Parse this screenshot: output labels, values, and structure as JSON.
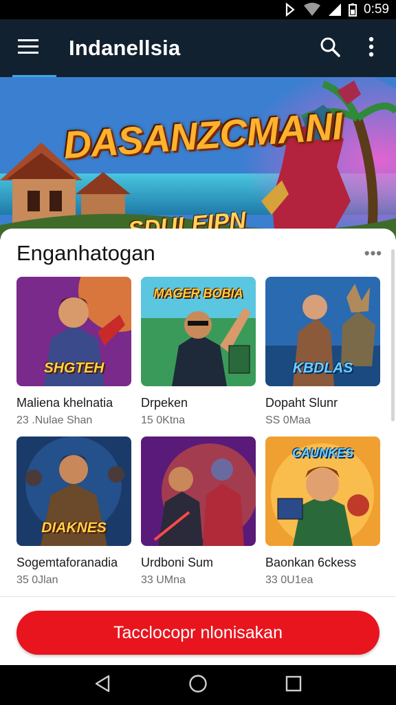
{
  "status_bar": {
    "time": "0:59",
    "icons": [
      "nfc-icon",
      "wifi-icon",
      "signal-icon",
      "battery-icon"
    ]
  },
  "app_bar": {
    "title": "Indanellsia",
    "icons": [
      "menu-icon",
      "search-icon",
      "more-vert-icon"
    ]
  },
  "hero": {
    "title": "DASANZCMANI",
    "subtitle": "SDULEIPN"
  },
  "section": {
    "title": "Enganhatogan",
    "more_label": "•••",
    "games": [
      {
        "title": "Maliena khelnatia",
        "subtitle": "23 .Nulae Shan",
        "art_text": "SHGTEH",
        "art_text_position": "bottom"
      },
      {
        "title": "Drpeken",
        "subtitle": "15 0Ktna",
        "art_text": "MAGER BOBIA",
        "art_text_position": "top"
      },
      {
        "title": "Dopaht Slunr",
        "subtitle": "SS 0Maa",
        "art_text": "KBDLAS",
        "art_text_position": "bottom"
      },
      {
        "title": "Sogemtaforanadia",
        "subtitle": "35 0Jlan",
        "art_text": "DIAKNES",
        "art_text_position": "bottom"
      },
      {
        "title": "Urdboni Sum",
        "subtitle": "33 UMna",
        "art_text": "",
        "art_text_position": "none"
      },
      {
        "title": "Baonkan 6ckess",
        "subtitle": "33 0U1ea",
        "art_text": "CAUNKES",
        "art_text_position": "top"
      }
    ]
  },
  "cta": {
    "label": "Tacclocopr nlonisakan"
  },
  "nav_bar": {
    "icons": [
      "back-icon",
      "home-icon",
      "recents-icon"
    ]
  },
  "colors": {
    "app_bar": "#12212f",
    "accent": "#3ea7e6",
    "cta": "#e8151e"
  }
}
